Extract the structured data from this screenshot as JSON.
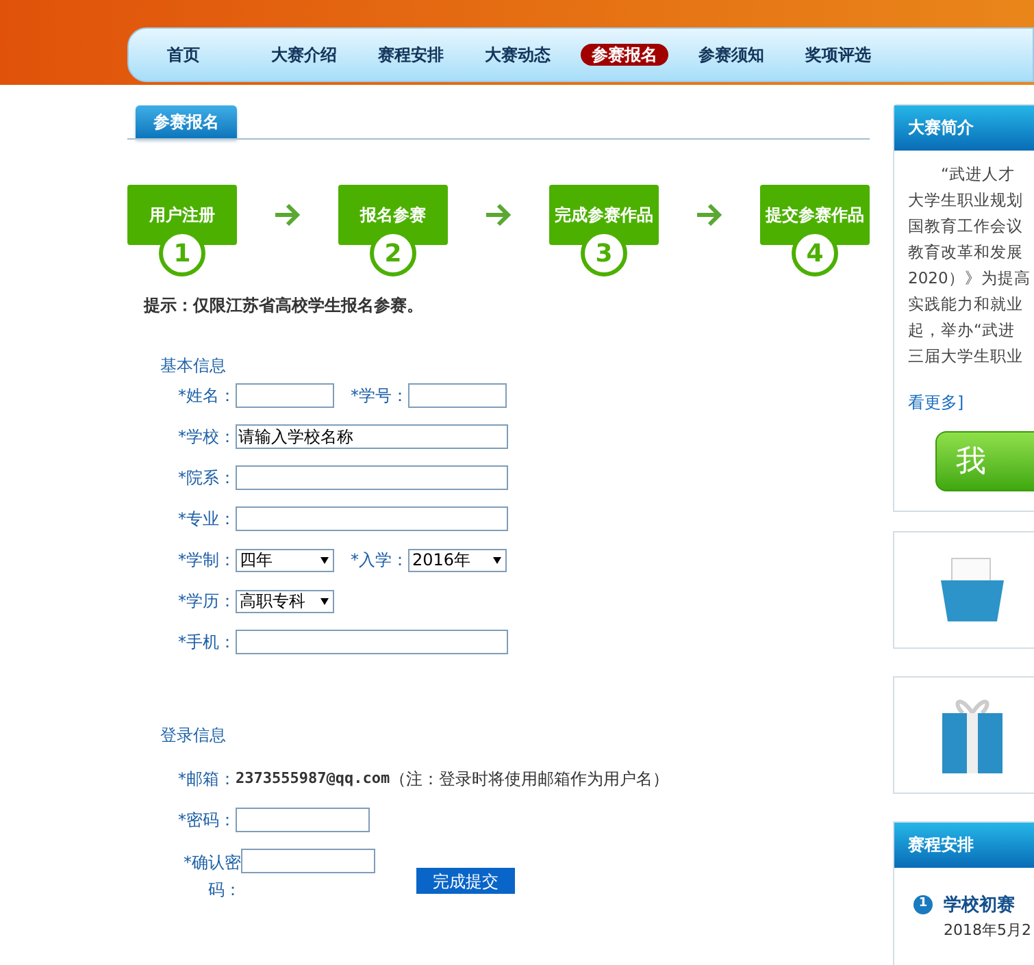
{
  "nav": [
    {
      "label": "首页",
      "selected": false
    },
    {
      "label": "大赛介绍",
      "selected": false
    },
    {
      "label": "赛程安排",
      "selected": false
    },
    {
      "label": "大赛动态",
      "selected": false
    },
    {
      "label": "参赛报名",
      "selected": true
    },
    {
      "label": "参赛须知",
      "selected": false
    },
    {
      "label": "奖项评选",
      "selected": false
    }
  ],
  "section_tab": "参赛报名",
  "steps": [
    {
      "label": "用户注册",
      "number": "1"
    },
    {
      "label": "报名参赛",
      "number": "2"
    },
    {
      "label": "完成参赛作品",
      "number": "3"
    },
    {
      "label": "提交参赛作品",
      "number": "4"
    }
  ],
  "notice": "提示：仅限江苏省高校学生报名参赛。",
  "basic_info": {
    "title": "基本信息",
    "rows": [
      [
        {
          "kind": "short_input",
          "label": "*姓名："
        },
        {
          "kind": "short_input",
          "label": "*学号："
        }
      ],
      [
        {
          "kind": "input",
          "label": "*学校：",
          "value": "请输入学校名称"
        }
      ],
      [
        {
          "kind": "input",
          "label": "*院系："
        }
      ],
      [
        {
          "kind": "input",
          "label": "*专业："
        }
      ],
      [
        {
          "kind": "select",
          "label": "*学制：",
          "value": "四年"
        },
        {
          "kind": "select",
          "label": "*入学：",
          "value": "2016年"
        }
      ],
      [
        {
          "kind": "select",
          "label": "*学历：",
          "value": "高职专科"
        }
      ],
      [
        {
          "kind": "input",
          "label": "*手机："
        }
      ]
    ]
  },
  "login_info": {
    "title": "登录信息",
    "email": {
      "label": "*邮箱：",
      "value": "2373555987@qq.com",
      "note": "（注：登录时将使用邮箱作为用户名）"
    },
    "password": {
      "label": "*密码："
    },
    "confirm": {
      "label": "*确认密码："
    },
    "submit": "完成提交"
  },
  "sidebar": {
    "intro": {
      "title": "大赛简介",
      "lines": [
        "“武进人才",
        "大学生职业规划",
        "国教育工作会议",
        "教育改革和发展",
        "2020）》为提高",
        "实践能力和就业",
        "起，举办“武进",
        "三届大学生职业"
      ],
      "more": "看更多]",
      "button": "我"
    },
    "schedule": {
      "title": "赛程安排",
      "items": [
        {
          "number": "1",
          "title": "学校初赛",
          "date": "2018年5月2"
        }
      ]
    }
  }
}
